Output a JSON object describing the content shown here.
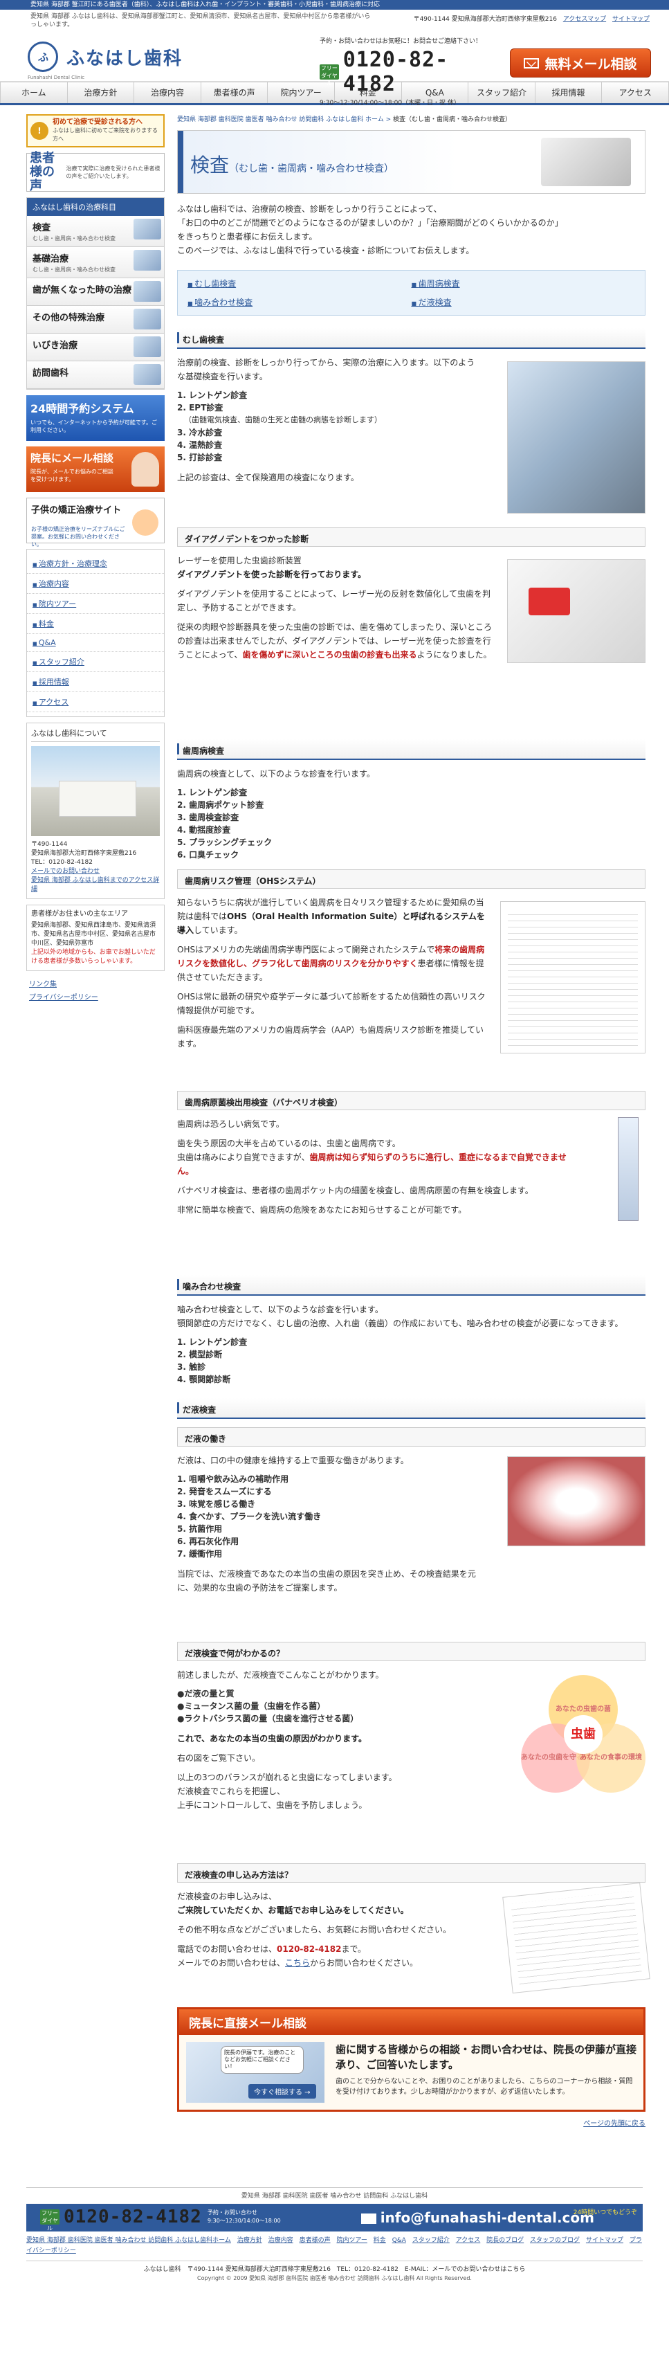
{
  "topbar": "愛知県 海部郡 蟹江町にある歯医者（歯科）、ふなはし歯科は入れ歯・インプラント・審美歯科・小児歯科・歯周病治療に対応",
  "header": {
    "subline": "愛知県 海部郡 ふなはし歯科は、愛知県海部郡蟹江町と、愛知県清須市、愛知県名古屋市、愛知県中村区から患者様がいらっしゃいます。",
    "address": "〒490-1144 愛知県海部郡大治町西條字東屋敷216",
    "access_link": "アクセスマップ",
    "sitemap_link": "サイトマップ",
    "logo_mark": "ふ",
    "logo_name": "ふなはし歯科",
    "logo_roman": "Funahashi Dental Clinic",
    "tel_note": "予約・お問い合わせはお気軽に！お問合せご連絡下さい！",
    "tel_free": "フリーダイヤル",
    "tel_number": "0120-82-4182",
    "tel_hours": "9:30〜12:30/14:00〜18:00（木曜・日・祝 休）",
    "mail_button": "無料メール相談"
  },
  "nav": [
    "ホーム",
    "治療方針",
    "治療内容",
    "患者様の声",
    "院内ツアー",
    "料金",
    "Q&A",
    "スタッフ紹介",
    "採用情報",
    "アクセス"
  ],
  "side": {
    "first_visit": "初めて治療で受診される方へ",
    "first_visit_sub": "ふなはし歯科に初めてご来院をおりまする方へ",
    "voice_title": "患者様の声",
    "voice_desc": "治療で実際に治療を受けられた患者様の声をご紹介いたします。",
    "treat_head": "ふなはし歯科の治療科目",
    "treat_items": [
      {
        "title": "検査",
        "sub": "むし歯・歯周病・噛み合わせ検査"
      },
      {
        "title": "基礎治療",
        "sub": "むし歯・歯周病・噛み合わせ検査"
      },
      {
        "title": "歯が無くなった時の治療",
        "sub": ""
      },
      {
        "title": "その他の特殊治療",
        "sub": ""
      },
      {
        "title": "いびき治療",
        "sub": ""
      },
      {
        "title": "訪問歯科",
        "sub": ""
      }
    ],
    "reserve_title": "24時間予約システム",
    "reserve_desc": "いつでも、インターネットから予約が可能です。ご利用ください。",
    "mail_title": "院長にメール相談",
    "mail_desc": "院長が、メールでお悩みのご相談を受けつけます。",
    "kids_title": "子供の矯正治療サイト",
    "kids_desc": "お子様の矯正治療をリーズナブルにご提案。お気軽にお問い合わせください。",
    "links": [
      "治療方針・治療理念",
      "治療内容",
      "院内ツアー",
      "料金",
      "Q&A",
      "スタッフ紹介",
      "採用情報",
      "アクセス"
    ],
    "about_head": "ふなはし歯科について",
    "about_zip": "〒490-1144",
    "about_addr": "愛知県海部郡大治町西條字東屋敷216",
    "about_tel": "TEL：0120-82-4182",
    "about_link1": "メールでのお問い合わせ",
    "about_link2": "愛知県 海部郡 ふなはし歯科までのアクセス詳細",
    "area_head": "患者様がお住まいの主なエリア",
    "area_text": "愛知県海部郡、愛知県西津島市、愛知県清須市、愛知県名古屋市中村区、愛知県名古屋市中川区、愛知県弥富市",
    "area_red": "上記以外の地域からも、お車でお越しいただける患者様が多数いらっしゃいます。",
    "foot_link1": "リンク集",
    "foot_link2": "プライバシーポリシー"
  },
  "main": {
    "crumb_link": "愛知県 海部郡 歯科医院 歯医者 噛み合わせ 訪問歯科 ふなはし歯科 ホーム",
    "crumb_current": "検査（むし歯・歯周病・噛み合わせ検査）",
    "title": "検査",
    "title_sub": "（むし歯・歯周病・噛み合わせ検査）",
    "lead1": "ふなはし歯科では、治療前の検査、診断をしっかり行うことによって、",
    "lead2": "「お口の中のどこが問題でどのようになさるのが望ましいのか？」「治療期間がどのくらいかかるのか」",
    "lead3": "をきっちりと患者様にお伝えします。",
    "lead4": "このページでは、ふなはし歯科で行っている検査・診断についてお伝えします。",
    "toc": [
      "むし歯検査",
      "歯周病検査",
      "噛み合わせ検査",
      "だ液検査"
    ],
    "mushiba": {
      "head": "むし歯検査",
      "p1": "治療前の検査、診断をしっかり行ってから、実際の治療に入ります。以下のような基礎検査を行います。",
      "items": [
        "1. レントゲン診査",
        "2. EPT診査",
        "3. 冷水診査",
        "4. 温熱診査",
        "5. 打診診査"
      ],
      "item2_note": "（歯髄電気検査、歯髄の生死と歯髄の病態を診断します）",
      "p2": "上記の診査は、全て保険適用の検査になります。",
      "sub_head": "ダイアグノデントをつかった診断",
      "sub_p1": "レーザーを使用した虫歯診断装置",
      "sub_p1b": "ダイアグノデントを使った診断を行っております。",
      "sub_p2": "ダイアグノデントを使用することによって、レーザー光の反射を数値化して虫歯を判定し、予防することができます。",
      "sub_p3": "従来の肉眼や診断器具を使った虫歯の診断では、歯を傷めてしまったり、深いところの診査は出来ませんでしたが、ダイアグノデントでは、レーザー光を使った診査を行うことによって、",
      "sub_p3red": "歯を傷めずに深いところの虫歯の診査も出来る",
      "sub_p3end": "ようになりました。"
    },
    "shishu": {
      "head": "歯周病検査",
      "p1": "歯周病の検査として、以下のような診査を行います。",
      "items": [
        "1. レントゲン診査",
        "2. 歯周病ポケット診査",
        "3. 歯周検査診査",
        "4. 動揺度診査",
        "5. プラッシングチェック",
        "6. 口臭チェック"
      ],
      "risk_head": "歯周病リスク管理（OHSシステム）",
      "risk_p1": "知らないうちに病状が進行していく歯周病を日々リスク管理するために愛知県の当院は歯科では",
      "risk_p1b": "OHS（Oral Health Information Suite）と呼ばれるシステムを導入",
      "risk_p1c": "しています。",
      "risk_p2": "OHSはアメリカの先端歯周病学専門医によって開発されたシステムで",
      "risk_p2red": "将来の歯周病リスクを数値化し、グラフ化して歯周病のリスクを分かりやすく",
      "risk_p2end": "患者様に情報を提供させていただきます。",
      "risk_p3": "OHSは常に最新の研究や疫学データに基づいて診断をするため信頼性の高いリスク情報提供が可能です。",
      "risk_p4": "歯科医療最先端のアメリカの歯周病学会（AAP）も歯周病リスク診断を推奨しています。",
      "bana_head": "歯周病原菌検出用検査（バナペリオ検査）",
      "bana_p1": "歯周病は恐ろしい病気です。",
      "bana_p2": "歯を失う原因の大半を占めているのは、虫歯と歯周病です。",
      "bana_p3": "虫歯は痛みにより自覚できますが、",
      "bana_p3red": "歯周病は知らず知らずのうちに進行し、重症になるまで自覚できません。",
      "bana_p4": "バナペリオ検査は、患者様の歯周ポケット内の細菌を検査し、歯周病原菌の有無を検査します。",
      "bana_p5": "非常に簡単な検査で、歯周病の危険をあなたにお知らせすることが可能です。"
    },
    "kamiawase": {
      "head": "噛み合わせ検査",
      "p1": "噛み合わせ検査として、以下のような診査を行います。",
      "p2": "顎関節症の方だけでなく、むし歯の治療、入れ歯（義歯）の作成においても、噛み合わせの検査が必要になってきます。",
      "items": [
        "1. レントゲン診査",
        "2. 模型診断",
        "3. 触診",
        "4. 顎関節診断"
      ]
    },
    "daeki": {
      "head": "だ液検査",
      "work_head": "だ液の働き",
      "work_p1": "だ液は、口の中の健康を維持する上で重要な働きがあります。",
      "work_items": [
        "1. 咀嚼や飲み込みの補助作用",
        "2. 発音をスムーズにする",
        "3. 味覚を感じる働き",
        "4. 食べかす、プラークを洗い流す働き",
        "5. 抗菌作用",
        "6. 再石灰化作用",
        "7. 緩衝作用"
      ],
      "work_p2": "当院では、だ液検査であなたの本当の虫歯の原因を突き止め、その検査結果を元に、効果的な虫歯の予防法をご提案します。",
      "know_head": "だ液検査で何がわかるの？",
      "know_p1": "前述しましたが、だ液検査でこんなことがわかります。",
      "know_items": [
        "●だ液の量と質",
        "●ミュータンス菌の量（虫歯を作る菌）",
        "●ラクトバシラス菌の量（虫歯を進行させる菌）"
      ],
      "know_p2": "これで、あなたの本当の虫歯の原因がわかります。",
      "know_p3": "右の図をご覧下さい。",
      "know_p4": "以上の3つのバランスが崩れると虫歯になってしまいます。",
      "know_p5": "だ液検査でこれらを把握し、",
      "know_p6": "上手にコントロールして、虫歯を予防しましょう。",
      "venn_top": "あなたの虫歯の菌",
      "venn_left": "あなたの虫歯を守る力",
      "venn_right": "あなたの食事の環境",
      "venn_core": "虫歯",
      "apply_head": "だ液検査の申し込み方法は？",
      "apply_p1": "だ液検査のお申し込みは、",
      "apply_p1b": "ご来院していただくか、お電話でお申し込みをしてください。",
      "apply_p2": "その他不明な点などがございましたら、お気軽にお問い合わせください。",
      "apply_p3": "電話でのお問い合わせは、",
      "apply_tel": "0120-82-4182",
      "apply_p3end": "まで。",
      "apply_p4": "メールでのお問い合わせは、",
      "apply_mail": "こちら",
      "apply_p4end": "からお問い合わせください。"
    },
    "consult": {
      "head": "院長に直接メール相談",
      "bubble": "院長の伊藤です。治療のことなどお気軽にご相談ください！",
      "btn": "今すぐ相談する →",
      "big": "歯に関する皆様からの相談・お問い合わせは、院長の伊藤が直接承り、ご回答いたします。",
      "small": "歯のことで分からないことや、お困りのことがありましたら、こちらのコーナーから相談・質問を受け付けております。少しお時間がかかりますが、必ず返信いたします。"
    },
    "pagetop": "ページの先頭に戻る"
  },
  "footer": {
    "line": "愛知県 海部郡 歯科医院 歯医者 噛み合わせ 訪問歯科 ふなはし歯科",
    "tel_free": "フリーダイヤル",
    "tel": "0120-82-4182",
    "hours1": "予約・お問い合わせ",
    "hours2": "9:30〜12:30/14:00〜18:00",
    "mail": "info@funahashi-dental.com",
    "acc": "24時間いつでもどうぞ",
    "links": [
      "愛知県 海部郡 歯科医院 歯医者 噛み合わせ 訪問歯科 ふなはし歯科ホーム",
      "治療方針",
      "治療内容",
      "患者様の声",
      "院内ツアー",
      "料金",
      "Q&A",
      "スタッフ紹介",
      "アクセス",
      "院長のブログ",
      "スタッフのブログ",
      "サイトマップ",
      "プライバシーポリシー"
    ],
    "addr": "ふなはし歯科　〒490-1144 愛知県海部郡大治町西條字東屋敷216　TEL：0120-82-4182　E-MAIL：メールでのお問い合わせはこちら",
    "copy": "Copyright © 2009 愛知県 海部郡 歯科医院 歯医者 噛み合わせ 訪問歯科 ふなはし歯科 All Rights Reserved."
  }
}
